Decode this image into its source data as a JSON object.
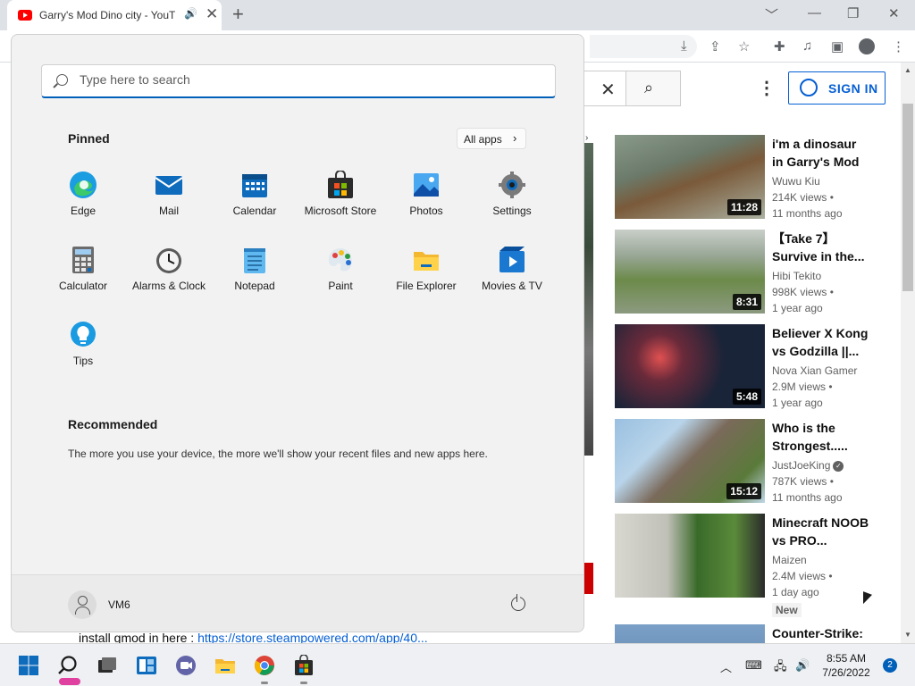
{
  "browser": {
    "tab_title": "Garry's Mod Dino city - YouTube",
    "new_tab": "+",
    "min": "﹀",
    "minimize": "—",
    "restore": "❐",
    "close": "✕"
  },
  "youtube": {
    "clear": "✕",
    "search_icon": "⌕",
    "more": "⋮",
    "sign_in": "SIGN IN",
    "desc_line_prefix": "install gmod in here : ",
    "desc_link": "https://store.steampowered.com/app/40...",
    "videos": [
      {
        "title": "i'm a dinosaur in Garry's Mod",
        "channel": "Wuwu Kiu",
        "views": "214K views •",
        "age": "11 months ago",
        "duration": "11:28",
        "verified": false
      },
      {
        "title": "【Take 7】Survive in the...",
        "channel": "Hibi Tekito",
        "views": "998K views •",
        "age": "1 year ago",
        "duration": "8:31",
        "verified": false
      },
      {
        "title": "Believer X Kong vs Godzilla ||...",
        "channel": "Nova Xian Gamer",
        "views": "2.9M views •",
        "age": "1 year ago",
        "duration": "5:48",
        "verified": false
      },
      {
        "title": "Who is the Strongest.....",
        "channel": "JustJoeKing",
        "views": "787K views •",
        "age": "11 months ago",
        "duration": "15:12",
        "verified": true
      },
      {
        "title": "Minecraft NOOB vs PRO...",
        "channel": "Maizen",
        "views": "2.4M views •",
        "age": "1 day ago",
        "duration": "",
        "badge": "New",
        "verified": false
      },
      {
        "title": "Counter-Strike:",
        "channel": "",
        "views": "",
        "age": "",
        "duration": "",
        "verified": false
      }
    ]
  },
  "start_menu": {
    "search_placeholder": "Type here to search",
    "pinned_title": "Pinned",
    "all_apps": "All apps",
    "pinned": [
      {
        "name": "Edge",
        "icon": "edge-icon"
      },
      {
        "name": "Mail",
        "icon": "mail-icon"
      },
      {
        "name": "Calendar",
        "icon": "calendar-icon"
      },
      {
        "name": "Microsoft Store",
        "icon": "store-icon"
      },
      {
        "name": "Photos",
        "icon": "photos-icon"
      },
      {
        "name": "Settings",
        "icon": "settings-icon"
      },
      {
        "name": "Calculator",
        "icon": "calculator-icon"
      },
      {
        "name": "Alarms & Clock",
        "icon": "clock-icon"
      },
      {
        "name": "Notepad",
        "icon": "notepad-icon"
      },
      {
        "name": "Paint",
        "icon": "paint-icon"
      },
      {
        "name": "File Explorer",
        "icon": "folder-icon"
      },
      {
        "name": "Movies & TV",
        "icon": "movies-icon"
      },
      {
        "name": "Tips",
        "icon": "tips-icon"
      }
    ],
    "recommended_title": "Recommended",
    "recommended_text": "The more you use your device, the more we'll show your recent files and new apps here.",
    "user_name": "VM6"
  },
  "taskbar": {
    "time": "8:55 AM",
    "date": "7/26/2022",
    "notifications": "2",
    "chevron": "︿"
  }
}
